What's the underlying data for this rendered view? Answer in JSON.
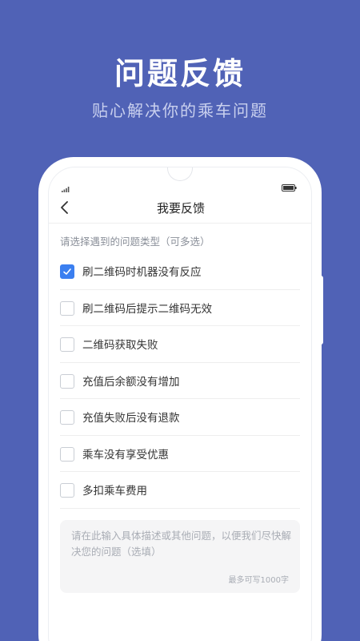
{
  "hero": {
    "title": "问题反馈",
    "subtitle": "贴心解决你的乘车问题"
  },
  "status_bar": {
    "signal_icon": "signal-icon",
    "battery_icon": "battery-icon"
  },
  "nav": {
    "back_icon": "back-arrow-icon",
    "title": "我要反馈"
  },
  "form": {
    "prompt": "请选择遇到的问题类型（可多选）",
    "options": [
      {
        "label": "刷二维码时机器没有反应",
        "checked": true
      },
      {
        "label": "刷二维码后提示二维码无效",
        "checked": false
      },
      {
        "label": "二维码获取失败",
        "checked": false
      },
      {
        "label": "充值后余额没有增加",
        "checked": false
      },
      {
        "label": "充值失败后没有退款",
        "checked": false
      },
      {
        "label": "乘车没有享受优惠",
        "checked": false
      },
      {
        "label": "多扣乘车费用",
        "checked": false
      }
    ],
    "textarea_placeholder": "请在此输入具体描述或其他问题，以便我们尽快解决您的问题（选填）",
    "counter": "最多可写1000字"
  },
  "colors": {
    "background": "#5062b6",
    "accent": "#3b7ff0"
  }
}
